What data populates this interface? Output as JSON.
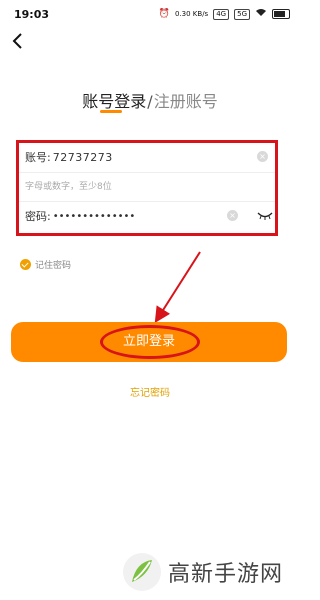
{
  "status_bar": {
    "time": "19:03",
    "speed": "0.30 KB/s",
    "net1": "4G",
    "net2": "5G"
  },
  "header": {
    "login_title": "账号登录",
    "separator": "/",
    "register_title": "注册账号"
  },
  "form": {
    "account_label": "账号:",
    "account_value": "72737273",
    "hint_text": "字母或数字，至少8位",
    "password_label": "密码:",
    "password_value": "••••••••••••••"
  },
  "remember": {
    "label": "记住密码"
  },
  "actions": {
    "login_label": "立即登录",
    "forgot_label": "忘记密码"
  },
  "watermark": {
    "text": "高新手游网"
  },
  "colors": {
    "accent": "#ff8a00",
    "annotation_red": "#d8141b"
  }
}
